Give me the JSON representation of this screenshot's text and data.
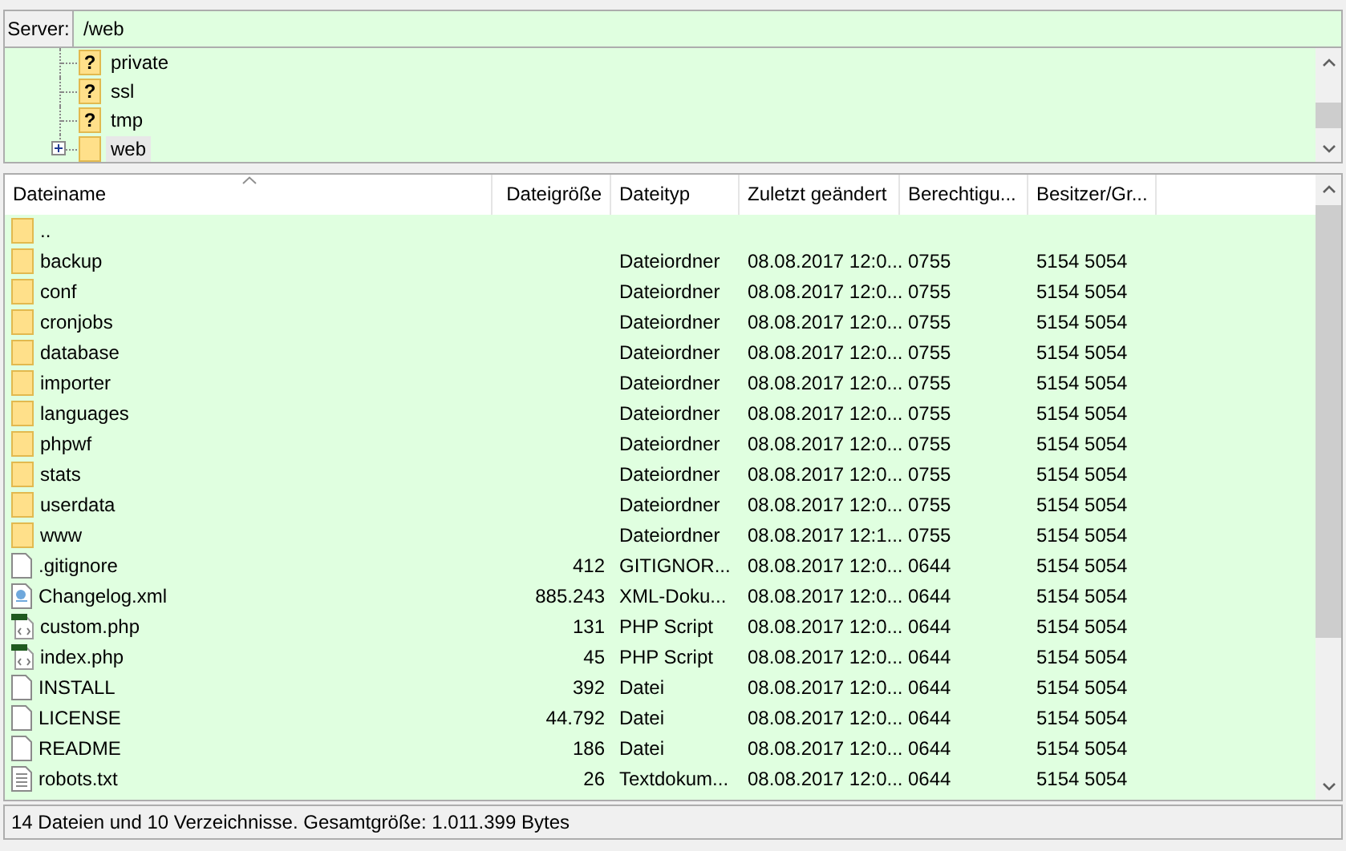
{
  "server_bar": {
    "label": "Server:",
    "path": "/web"
  },
  "tree": [
    {
      "name": "private",
      "kind": "unknown",
      "symbol": "?",
      "expandable": false,
      "selected": false
    },
    {
      "name": "ssl",
      "kind": "unknown",
      "symbol": "?",
      "expandable": false,
      "selected": false
    },
    {
      "name": "tmp",
      "kind": "unknown",
      "symbol": "?",
      "expandable": false,
      "selected": false
    },
    {
      "name": "web",
      "kind": "folder",
      "expandable": true,
      "selected": true
    }
  ],
  "table": {
    "columns": [
      {
        "label": "Dateiname",
        "sorted": true
      },
      {
        "label": "Dateigröße",
        "sorted": false
      },
      {
        "label": "Dateityp",
        "sorted": false
      },
      {
        "label": "Zuletzt geändert",
        "sorted": false
      },
      {
        "label": "Berechtigu...",
        "sorted": false
      },
      {
        "label": "Besitzer/Gr...",
        "sorted": false
      }
    ],
    "rows": [
      {
        "kind": "folder",
        "cells": [
          "..",
          "",
          "",
          "",
          "",
          ""
        ]
      },
      {
        "kind": "folder",
        "cells": [
          "backup",
          "",
          "Dateiordner",
          "08.08.2017 12:0...",
          "0755",
          "5154 5054"
        ]
      },
      {
        "kind": "folder",
        "cells": [
          "conf",
          "",
          "Dateiordner",
          "08.08.2017 12:0...",
          "0755",
          "5154 5054"
        ]
      },
      {
        "kind": "folder",
        "cells": [
          "cronjobs",
          "",
          "Dateiordner",
          "08.08.2017 12:0...",
          "0755",
          "5154 5054"
        ]
      },
      {
        "kind": "folder",
        "cells": [
          "database",
          "",
          "Dateiordner",
          "08.08.2017 12:0...",
          "0755",
          "5154 5054"
        ]
      },
      {
        "kind": "folder",
        "cells": [
          "importer",
          "",
          "Dateiordner",
          "08.08.2017 12:0...",
          "0755",
          "5154 5054"
        ]
      },
      {
        "kind": "folder",
        "cells": [
          "languages",
          "",
          "Dateiordner",
          "08.08.2017 12:0...",
          "0755",
          "5154 5054"
        ]
      },
      {
        "kind": "folder",
        "cells": [
          "phpwf",
          "",
          "Dateiordner",
          "08.08.2017 12:0...",
          "0755",
          "5154 5054"
        ]
      },
      {
        "kind": "folder",
        "cells": [
          "stats",
          "",
          "Dateiordner",
          "08.08.2017 12:0...",
          "0755",
          "5154 5054"
        ]
      },
      {
        "kind": "folder",
        "cells": [
          "userdata",
          "",
          "Dateiordner",
          "08.08.2017 12:0...",
          "0755",
          "5154 5054"
        ]
      },
      {
        "kind": "folder",
        "cells": [
          "www",
          "",
          "Dateiordner",
          "08.08.2017 12:1...",
          "0755",
          "5154 5054"
        ]
      },
      {
        "kind": "file",
        "cells": [
          ".gitignore",
          "412",
          "GITIGNOR...",
          "08.08.2017 12:0...",
          "0644",
          "5154 5054"
        ]
      },
      {
        "kind": "xml",
        "cells": [
          "Changelog.xml",
          "885.243",
          "XML-Doku...",
          "08.08.2017 12:0...",
          "0644",
          "5154 5054"
        ]
      },
      {
        "kind": "php",
        "cells": [
          "custom.php",
          "131",
          "PHP Script",
          "08.08.2017 12:0...",
          "0644",
          "5154 5054"
        ]
      },
      {
        "kind": "php",
        "cells": [
          "index.php",
          "45",
          "PHP Script",
          "08.08.2017 12:0...",
          "0644",
          "5154 5054"
        ]
      },
      {
        "kind": "file",
        "cells": [
          "INSTALL",
          "392",
          "Datei",
          "08.08.2017 12:0...",
          "0644",
          "5154 5054"
        ]
      },
      {
        "kind": "file",
        "cells": [
          "LICENSE",
          "44.792",
          "Datei",
          "08.08.2017 12:0...",
          "0644",
          "5154 5054"
        ]
      },
      {
        "kind": "file",
        "cells": [
          "README",
          "186",
          "Datei",
          "08.08.2017 12:0...",
          "0644",
          "5154 5054"
        ]
      },
      {
        "kind": "text",
        "cells": [
          "robots.txt",
          "26",
          "Textdokum...",
          "08.08.2017 12:0...",
          "0644",
          "5154 5054"
        ]
      }
    ]
  },
  "status_bar": "14 Dateien und 10 Verzeichnisse. Gesamtgröße: 1.011.399 Bytes"
}
